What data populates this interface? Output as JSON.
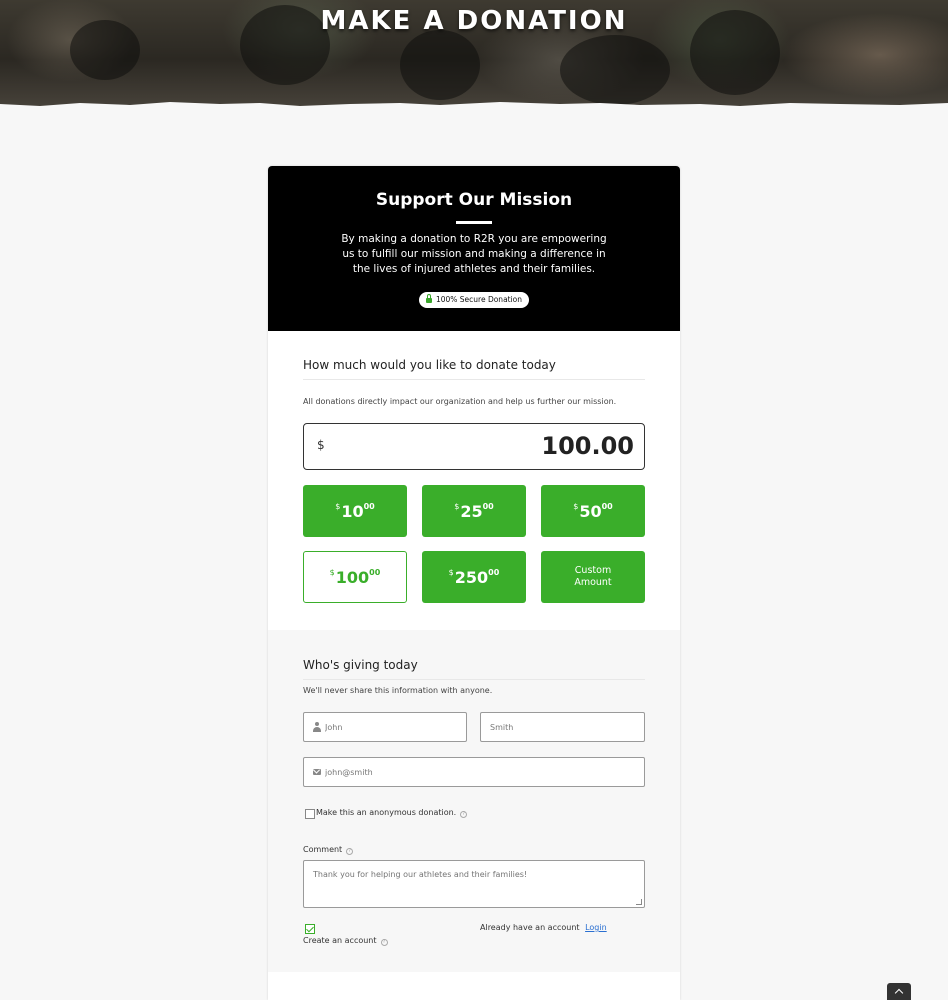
{
  "hero": {
    "title": "MAKE A DONATION"
  },
  "card": {
    "heading": "Support Our Mission",
    "mission_text": "By making a donation to R2R you are empowering us to fulfill our mission and making a difference in the lives of injured athletes and their families.",
    "secure_badge": "100% Secure Donation"
  },
  "donation": {
    "section_title": "How much would you like to donate today",
    "subtext": "All donations directly impact our organization and help us further our mission.",
    "currency_symbol": "$",
    "amount": "100.00",
    "levels": [
      {
        "symbol": "$",
        "whole": "10",
        "cents": "00",
        "selected": false
      },
      {
        "symbol": "$",
        "whole": "25",
        "cents": "00",
        "selected": false
      },
      {
        "symbol": "$",
        "whole": "50",
        "cents": "00",
        "selected": false
      },
      {
        "symbol": "$",
        "whole": "100",
        "cents": "00",
        "selected": true
      },
      {
        "symbol": "$",
        "whole": "250",
        "cents": "00",
        "selected": false
      }
    ],
    "custom_label": "Custom Amount"
  },
  "giver": {
    "section_title": "Who's giving today",
    "privacy_note": "We'll never share this information with anyone.",
    "first_name_placeholder": "John",
    "last_name_placeholder": "Smith",
    "email_placeholder": "john@smith",
    "anonymous_label": "Make this an anonymous donation.",
    "anonymous_checked": false,
    "comment_label": "Comment",
    "comment_placeholder": "Thank you for helping our athletes and their families!",
    "create_account_label": "Create an account",
    "create_account_checked": true,
    "already_account_text": "Already have an account",
    "login_link": "Login"
  },
  "colors": {
    "accent_green": "#3aae2a",
    "header_black": "#000000",
    "page_background": "#f7f7f7"
  },
  "icons": {
    "help": "?",
    "lock": "lock-icon",
    "user": "user-icon",
    "mail": "envelope-icon",
    "scroll_top": "chevron-up-icon"
  }
}
